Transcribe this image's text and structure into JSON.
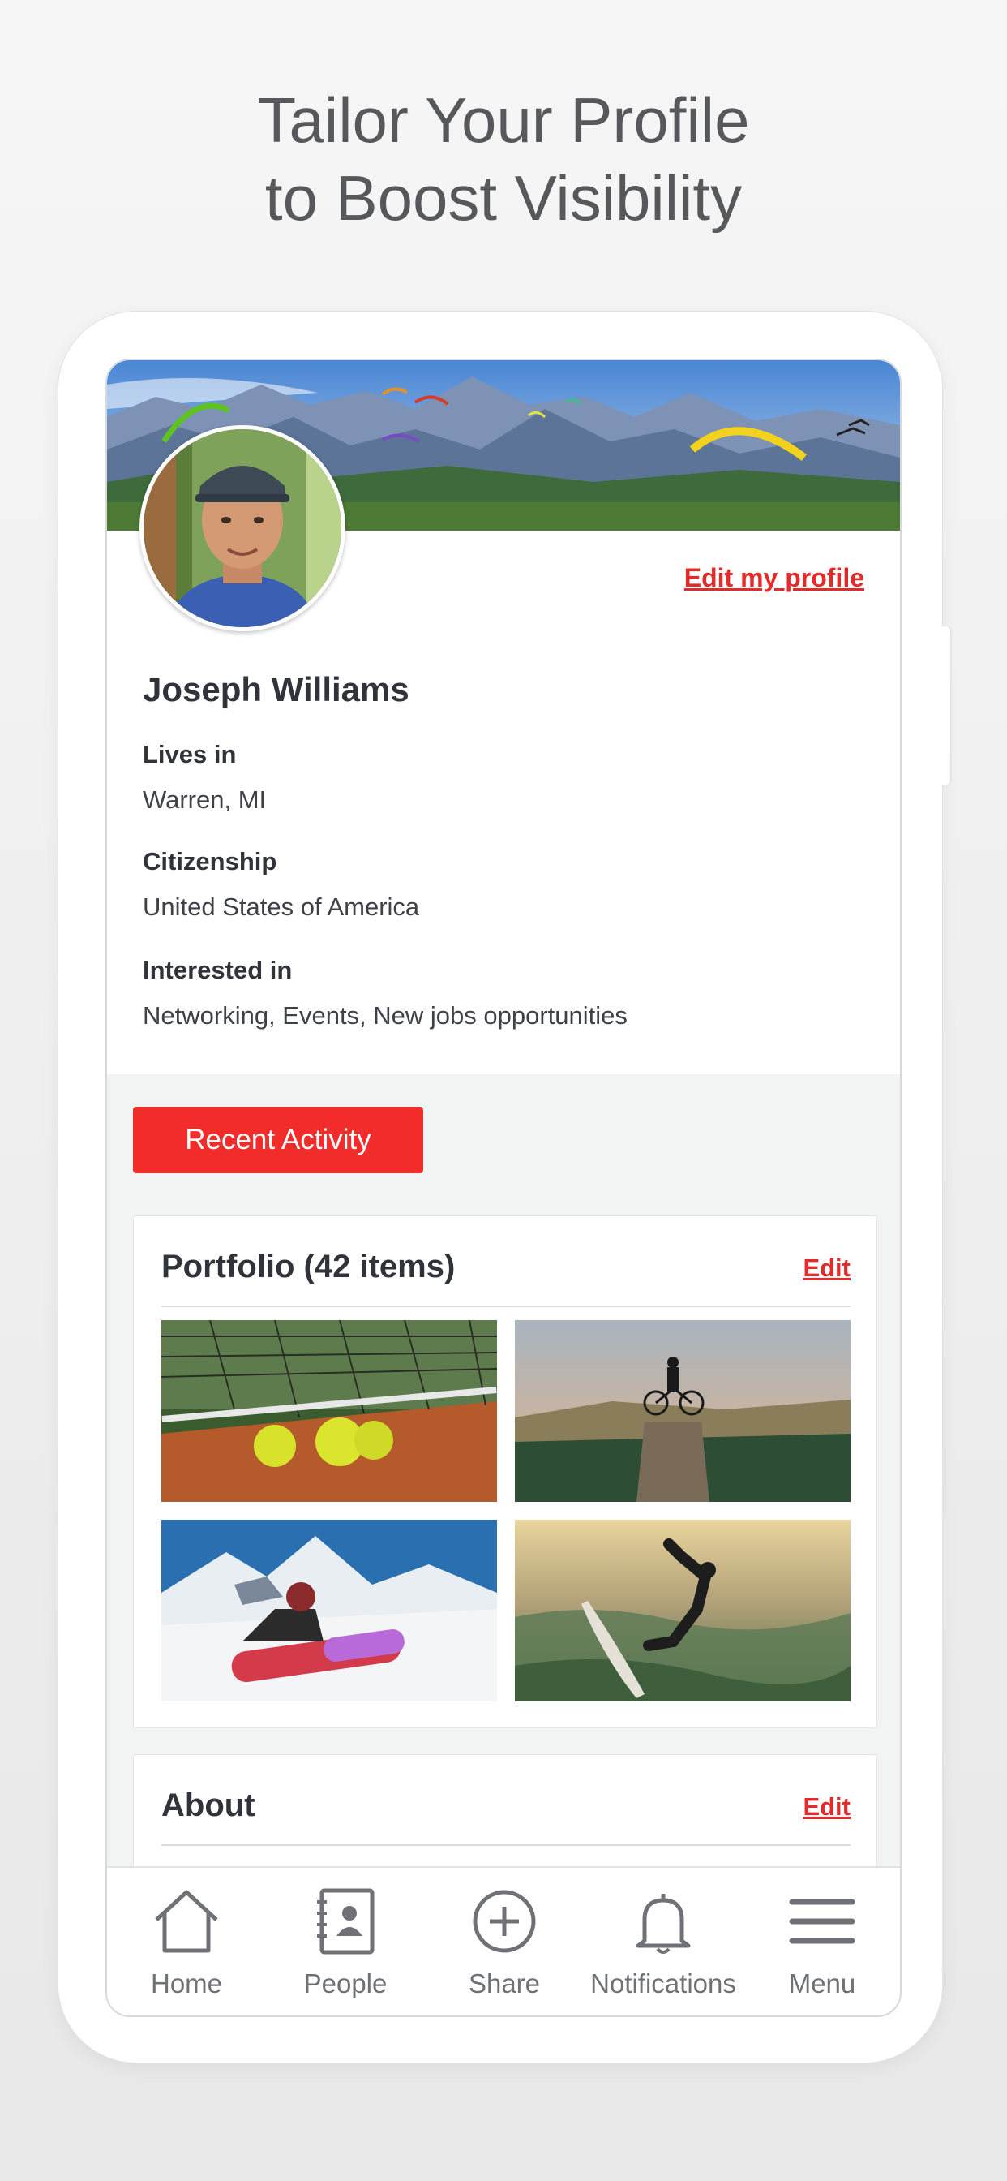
{
  "headline": {
    "line1": "Tailor Your Profile",
    "line2": "to Boost Visibility"
  },
  "profile": {
    "edit_link": "Edit my profile",
    "name": "Joseph Williams",
    "fields": [
      {
        "label": "Lives in",
        "value": "Warren, MI"
      },
      {
        "label": "Citizenship",
        "value": "United States of America"
      },
      {
        "label": "Interested in",
        "value": "Networking, Events, New jobs opportunities"
      }
    ]
  },
  "recent_activity": {
    "label": "Recent Activity"
  },
  "portfolio": {
    "title": "Portfolio (42 items)",
    "edit_label": "Edit"
  },
  "about": {
    "title": "About",
    "edit_label": "Edit"
  },
  "tabs": [
    {
      "label": "Home",
      "icon": "home-icon"
    },
    {
      "label": "People",
      "icon": "contacts-icon"
    },
    {
      "label": "Share",
      "icon": "plus-circle-icon"
    },
    {
      "label": "Notifications",
      "icon": "bell-icon"
    },
    {
      "label": "Menu",
      "icon": "hamburger-menu-icon"
    }
  ],
  "colors": {
    "accent": "#f22b2b",
    "link": "#e42b2b",
    "text": "#30333a",
    "muted": "#6f7176"
  }
}
